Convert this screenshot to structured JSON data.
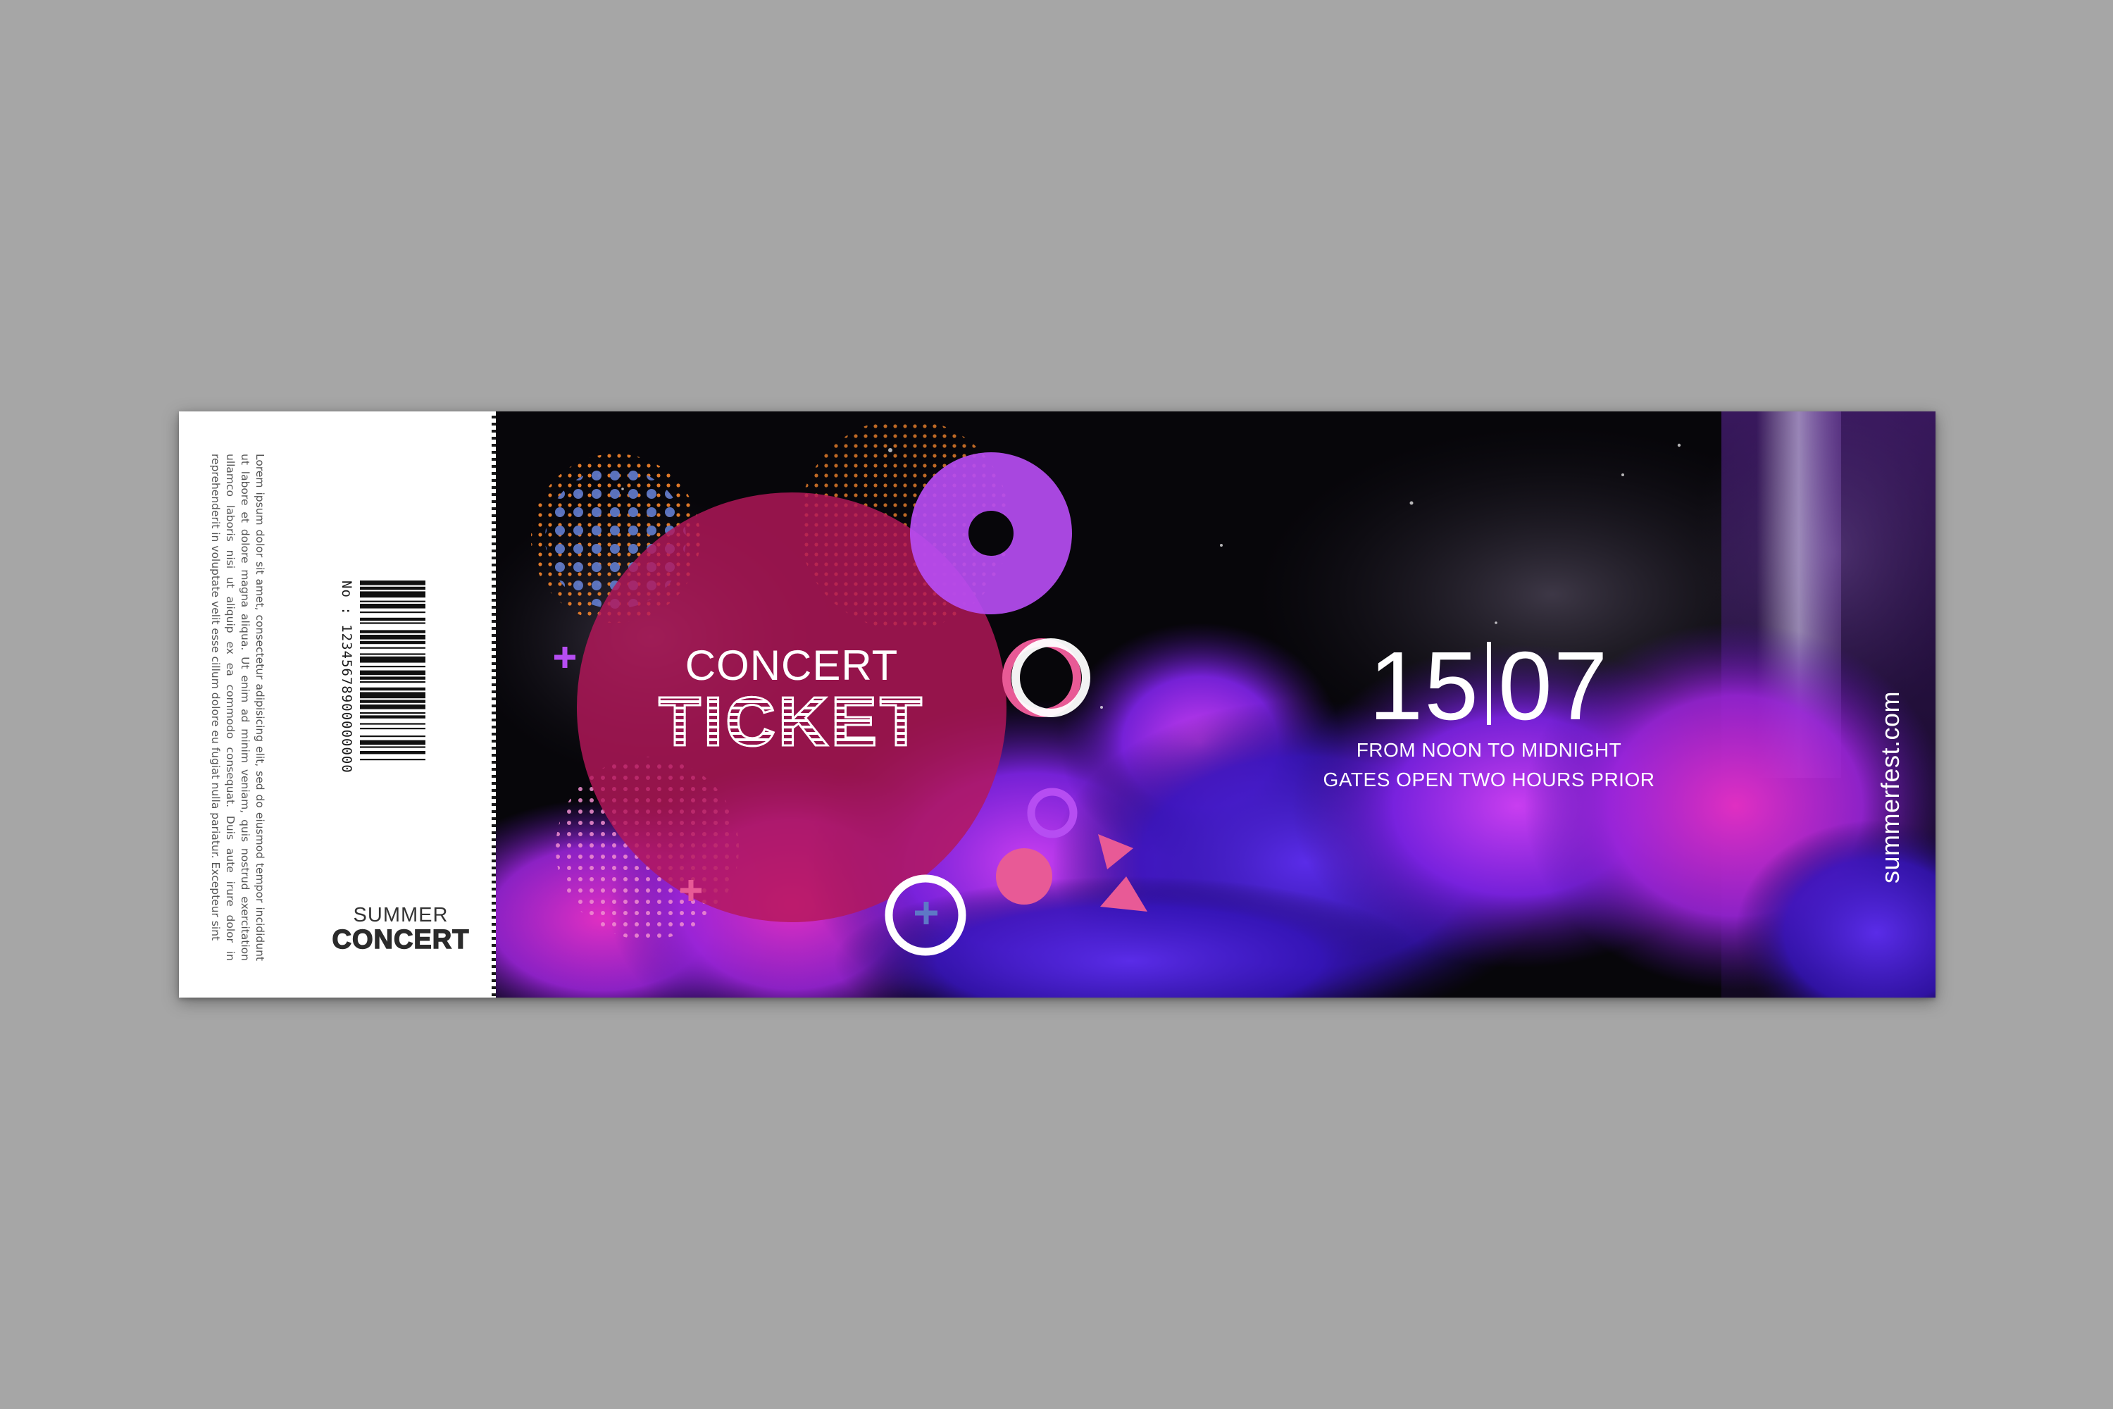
{
  "stub": {
    "fine_print": "Lorem ipsum dolor sit amet, consectetur adipisicing elit, sed do eiusmod tempor incididunt ut labore et dolore magna aliqua. Ut enim ad minim veniam, quis nostrud exercitation ullamco laboris nisi ut aliquip ex ea commodo consequat. Duis aute irure dolor in reprehenderit in voluptate velit esse cillum dolore eu fugiat nulla pariatur. Excepteur sint",
    "ticket_number": "No : 12345678900000000",
    "brand_top": "SUMMER",
    "brand_bottom": "CONCERT"
  },
  "main": {
    "title_top": "CONCERT",
    "title_bottom": "TICKET",
    "date_day": "15",
    "date_month": "07",
    "time_line": "FROM NOON TO MIDNIGHT",
    "gates_line": "GATES OPEN TWO HOURS PRIOR",
    "website": "summerfest.com"
  },
  "colors": {
    "page_background": "#a6a6a6",
    "stub_background": "#ffffff",
    "main_background": "#07060a",
    "magenta_circle": "#b5175a",
    "violet_circle": "#b64df2",
    "pink_ring": "#e85a96",
    "orange_dots": "#e07a2a",
    "blue_dots": "#5e78c6",
    "smoke_purple": "#7b22e0",
    "smoke_magenta": "#d326c9"
  },
  "icons": [
    "barcode-graphic",
    "plus-icon",
    "ring-icon",
    "triangle-icon",
    "dot-pattern"
  ]
}
